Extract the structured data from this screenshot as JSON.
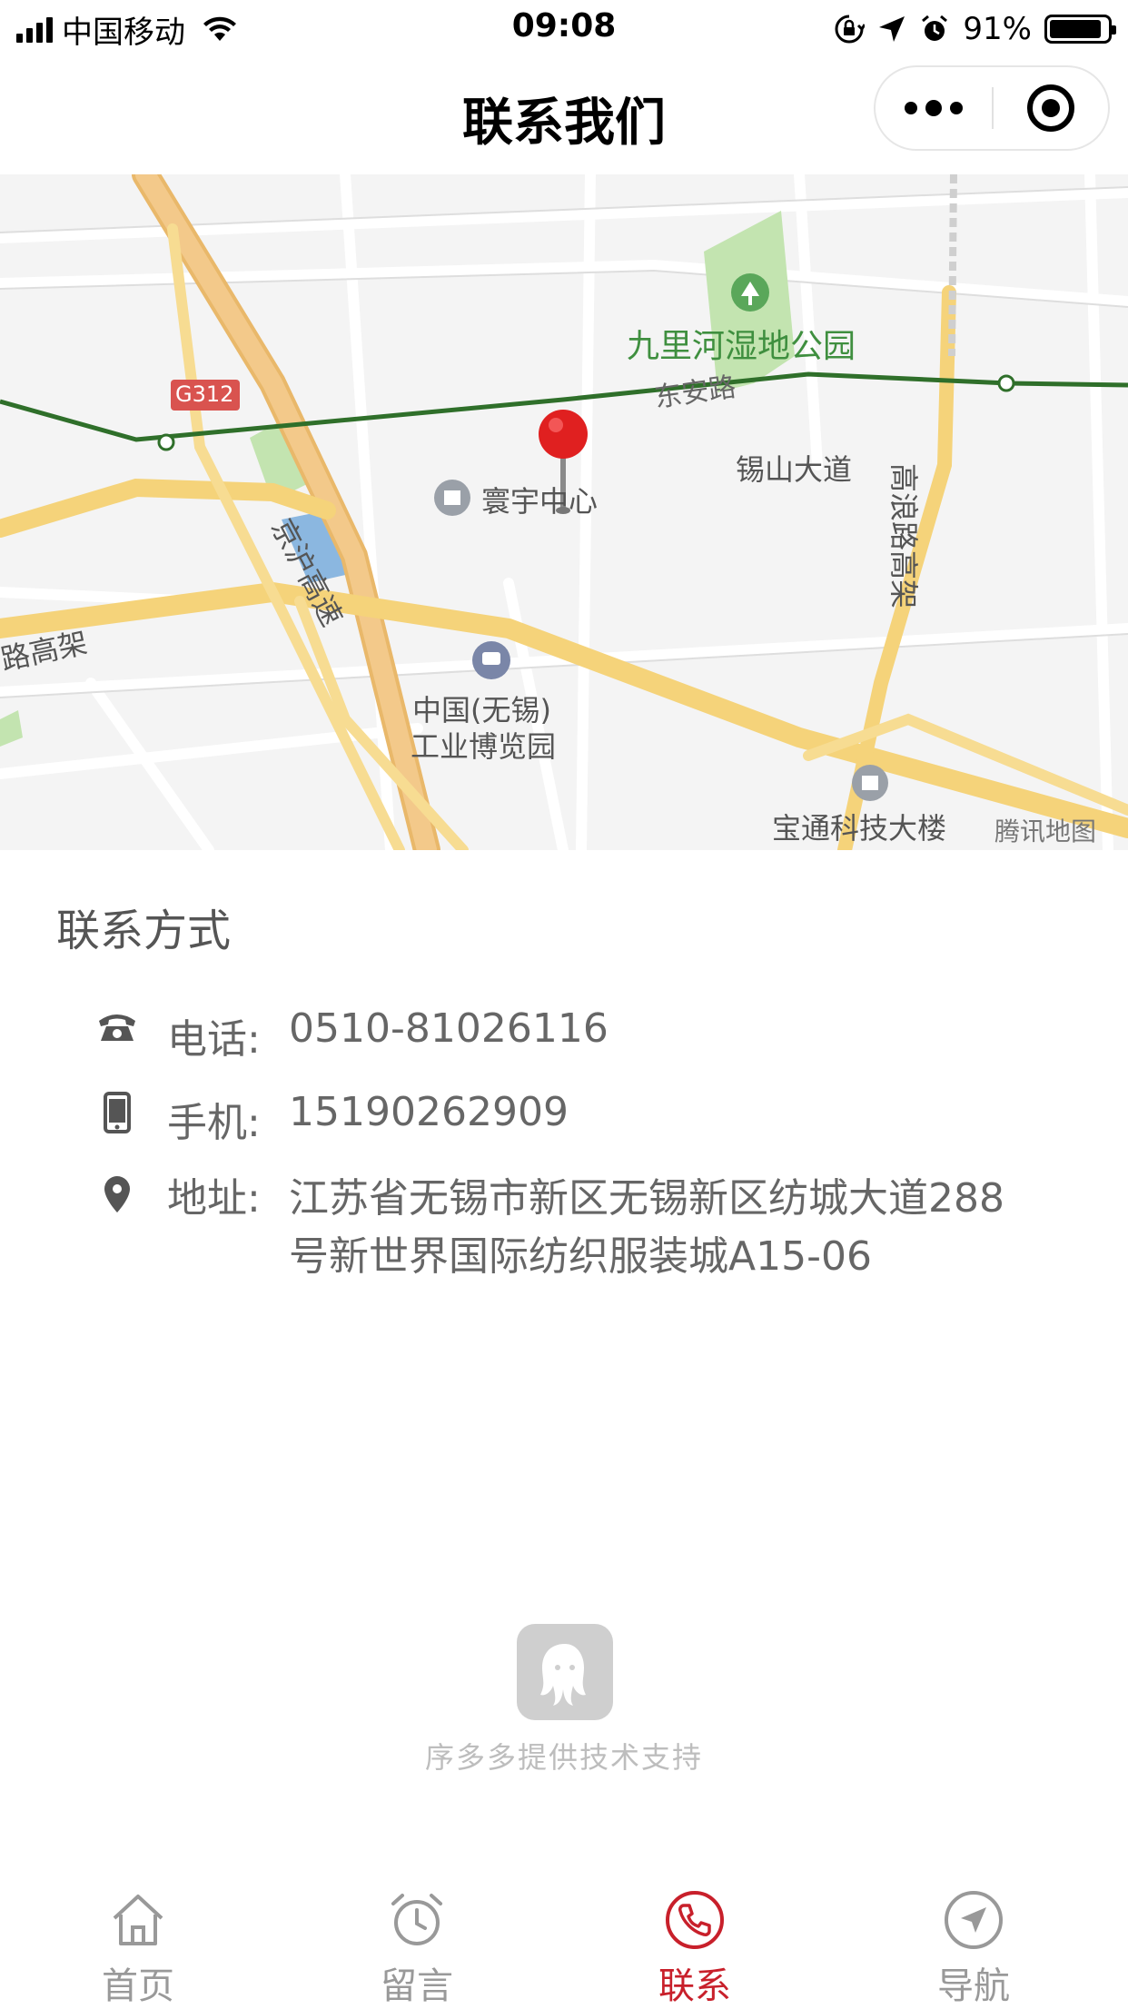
{
  "status_bar": {
    "carrier": "中国移动",
    "time": "09:08",
    "battery": "91%",
    "battery_level": 0.91
  },
  "nav": {
    "title": "联系我们"
  },
  "map": {
    "labels": {
      "park": "九里河湿地公园",
      "dongan_road": "东安路",
      "g312": "G312",
      "jinghu": "京沪高速",
      "xishan": "锡山大道",
      "huanyu": "寰宇中心",
      "gaolang": "高浪路高架",
      "gaojia": "路高架",
      "expo_line1": "中国(无锡)",
      "expo_line2": "工业博览园",
      "baotong": "宝通科技大楼",
      "tencent": "腾讯地图"
    }
  },
  "contact": {
    "section_title": "联系方式",
    "phone_label": "电话:",
    "phone_value": "0510-81026116",
    "mobile_label": "手机:",
    "mobile_value": "15190262909",
    "address_label": "地址:",
    "address_value": "江苏省无锡市新区无锡新区纺城大道288号新世界国际纺织服装城A15-06"
  },
  "footer": {
    "support_text": "序多多提供技术支持"
  },
  "tabs": [
    {
      "label": "首页",
      "icon": "home-icon"
    },
    {
      "label": "留言",
      "icon": "alarm-clock-icon"
    },
    {
      "label": "联系",
      "icon": "phone-icon"
    },
    {
      "label": "导航",
      "icon": "compass-navigation-icon"
    }
  ],
  "colors": {
    "accent": "#c8202b",
    "tab_inactive": "#999999",
    "road_yellow": "#f5d37a",
    "subway_green": "#2f6f2a",
    "park_green": "#c3e4b0"
  }
}
